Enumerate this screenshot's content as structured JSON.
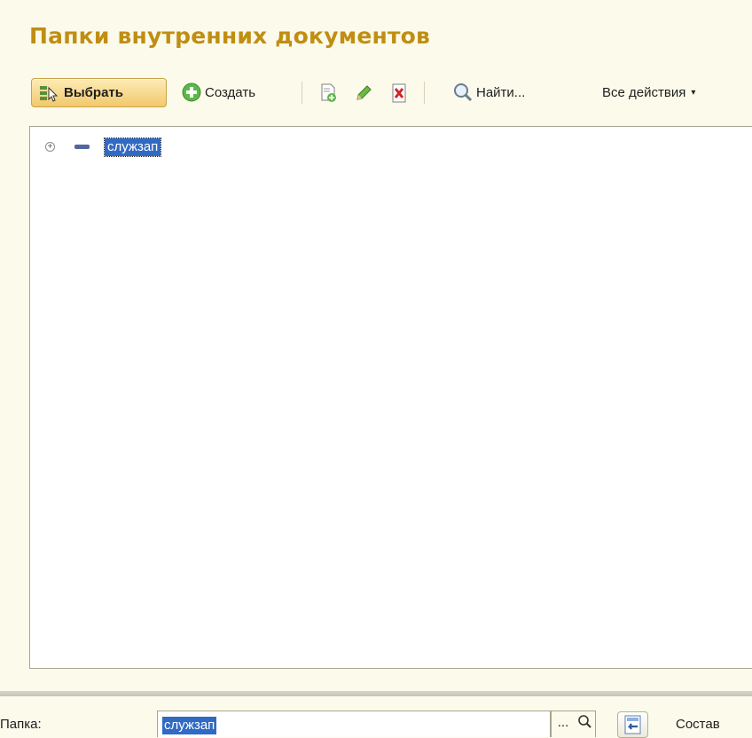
{
  "header": {
    "title": "Папки внутренних документов"
  },
  "toolbar": {
    "select_label": "Выбрать",
    "create_label": "Создать",
    "find_label": "Найти...",
    "all_actions_label": "Все действия",
    "all_actions_caret": "▾"
  },
  "tree": {
    "items": [
      {
        "label": "служзап",
        "expander": "+",
        "selected": true
      }
    ]
  },
  "footer": {
    "folder_label": "Папка:",
    "folder_value": "служзап",
    "pick_label": "...",
    "composition_label": "Состав"
  },
  "colors": {
    "title": "#c08e12",
    "background": "#fbfaeb",
    "selection": "#316ac5",
    "primary_button": "#f2c96c"
  }
}
